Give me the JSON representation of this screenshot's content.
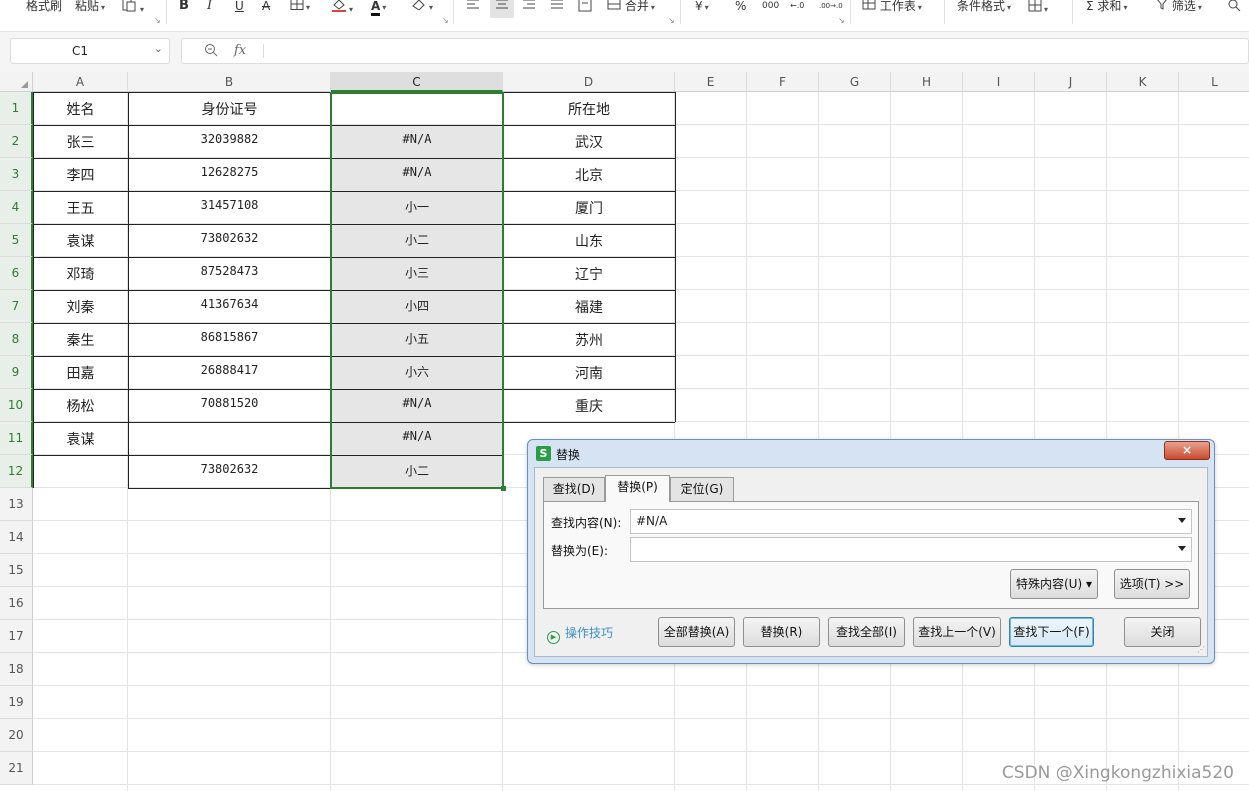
{
  "ribbon": {
    "format_painter": "格式刷",
    "paste": "粘贴",
    "bold": "B",
    "italic": "I",
    "underline": "U",
    "strike": "A",
    "font_color": "A",
    "merge": "合并",
    "currency": "¥",
    "percent": "%",
    "thousands": "000",
    "inc_decimal": "←.0",
    "dec_decimal": ".00→.0",
    "worksheet": "工作表",
    "conditional_format": "条件格式",
    "sum": "求和",
    "filter": "筛选"
  },
  "formula_bar": {
    "name_box": "C1",
    "fx": "fx",
    "formula": ""
  },
  "sheet": {
    "columns": [
      "A",
      "B",
      "C",
      "D",
      "E",
      "F",
      "G",
      "H",
      "I",
      "J",
      "K",
      "L"
    ],
    "rows": [
      "1",
      "2",
      "3",
      "4",
      "5",
      "6",
      "7",
      "8",
      "9",
      "10",
      "11",
      "12",
      "13",
      "14",
      "15",
      "16",
      "17",
      "18",
      "19",
      "20",
      "21"
    ],
    "selected_column": "C",
    "cells": [
      [
        "姓名",
        "身份证号",
        "",
        "所在地"
      ],
      [
        "张三",
        "32039882",
        "#N/A",
        "武汉"
      ],
      [
        "李四",
        "12628275",
        "#N/A",
        "北京"
      ],
      [
        "王五",
        "31457108",
        "小一",
        "厦门"
      ],
      [
        "袁谋",
        "73802632",
        "小二",
        "山东"
      ],
      [
        "邓琦",
        "87528473",
        "小三",
        "辽宁"
      ],
      [
        "刘秦",
        "41367634",
        "小四",
        "福建"
      ],
      [
        "秦生",
        "86815867",
        "小五",
        "苏州"
      ],
      [
        "田嘉",
        "26888417",
        "小六",
        "河南"
      ],
      [
        "杨松",
        "70881520",
        "#N/A",
        "重庆"
      ],
      [
        "袁谋",
        "",
        "#N/A",
        ""
      ],
      [
        "",
        "73802632",
        "小二",
        ""
      ]
    ]
  },
  "dialog": {
    "title": "替换",
    "close_label": "×",
    "tabs": [
      {
        "label": "查找(D)"
      },
      {
        "label": "替换(P)"
      },
      {
        "label": "定位(G)"
      }
    ],
    "active_tab": "替换(P)",
    "find_label": "查找内容(N):",
    "find_value": "#N/A",
    "replace_label": "替换为(E):",
    "replace_value": "",
    "special_button": "特殊内容(U) ▾",
    "options_button": "选项(T) >>",
    "tips_link": "操作技巧",
    "buttons": {
      "replace_all": "全部替换(A)",
      "replace": "替换(R)",
      "find_all": "查找全部(I)",
      "find_prev": "查找上一个(V)",
      "find_next": "查找下一个(F)",
      "close": "关闭"
    }
  },
  "watermark": "CSDN @Xingkongzhixia520",
  "colors": {
    "selection": "#2e7d32",
    "dialog_bg": "#d5e3f3",
    "tips_link": "#3c8fc9"
  }
}
